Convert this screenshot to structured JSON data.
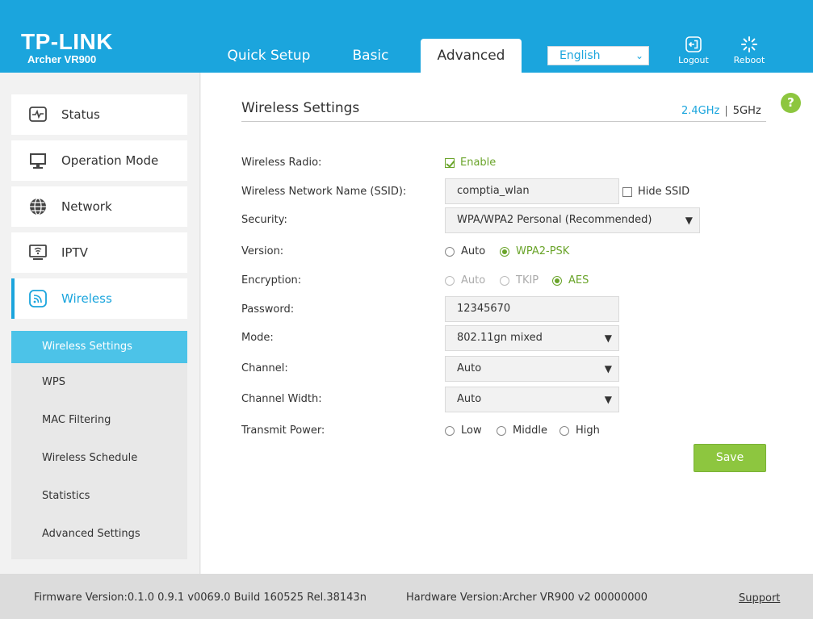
{
  "brand": {
    "logo": "TP-LINK",
    "model": "Archer VR900"
  },
  "tabs": [
    {
      "label": "Quick Setup"
    },
    {
      "label": "Basic"
    },
    {
      "label": "Advanced"
    }
  ],
  "language": {
    "selected": "English"
  },
  "header_buttons": {
    "logout": "Logout",
    "reboot": "Reboot"
  },
  "sidebar": {
    "items": [
      {
        "label": "Status",
        "icon": "status-icon"
      },
      {
        "label": "Operation Mode",
        "icon": "monitor-icon"
      },
      {
        "label": "Network",
        "icon": "globe-icon"
      },
      {
        "label": "IPTV",
        "icon": "iptv-icon"
      },
      {
        "label": "Wireless",
        "icon": "wireless-icon"
      }
    ],
    "wireless_submenu": [
      "Wireless Settings",
      "WPS",
      "MAC Filtering",
      "Wireless Schedule",
      "Statistics",
      "Advanced Settings"
    ]
  },
  "main": {
    "title": "Wireless Settings",
    "bands": {
      "band_24": "2.4GHz",
      "separator": "|",
      "band_5": "5GHz"
    },
    "help": "?",
    "labels": {
      "radio": "Wireless Radio:",
      "ssid": "Wireless Network Name (SSID):",
      "security": "Security:",
      "version": "Version:",
      "encryption": "Encryption:",
      "password": "Password:",
      "mode": "Mode:",
      "channel": "Channel:",
      "width": "Channel Width:",
      "power": "Transmit Power:"
    },
    "radio_enable": "Enable",
    "ssid_value": "comptia_wlan",
    "hide_ssid": "Hide SSID",
    "security_value": "WPA/WPA2 Personal (Recommended)",
    "version_options": [
      "Auto",
      "WPA2-PSK"
    ],
    "encryption_options": [
      "Auto",
      "TKIP",
      "AES"
    ],
    "password_value": "12345670",
    "mode_value": "802.11gn mixed",
    "channel_value": "Auto",
    "width_value": "Auto",
    "power_options": [
      "Low",
      "Middle",
      "High"
    ],
    "save": "Save"
  },
  "footer": {
    "firmware": "Firmware Version:0.1.0 0.9.1 v0069.0 Build 160525 Rel.38143n",
    "hardware": "Hardware Version:Archer VR900 v2 00000000",
    "support": "Support"
  },
  "colors": {
    "brand_blue": "#1ba5dd",
    "green": "#8dc63f",
    "active_sub": "#4cc3e8"
  }
}
